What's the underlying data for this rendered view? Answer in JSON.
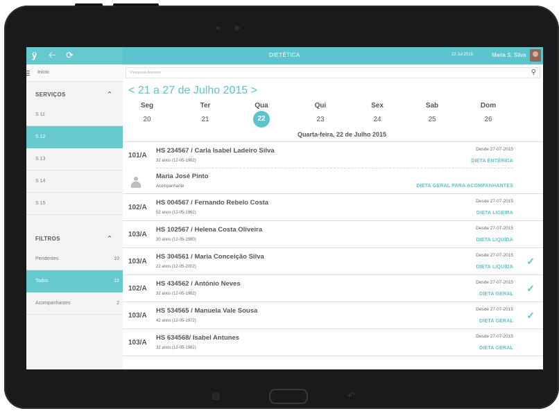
{
  "topbar": {
    "title": "DIETÉTICA",
    "date": "22 Jul 2015",
    "user": "Maria S. Silva",
    "icons": [
      "app-logo-icon",
      "back-arrow-icon",
      "refresh-icon"
    ]
  },
  "sidebar": {
    "start_label": "Início",
    "services_header": "SERVIÇOS",
    "services": [
      {
        "label": "S 11",
        "active": false
      },
      {
        "label": "S 12",
        "active": true
      },
      {
        "label": "S 13",
        "active": false
      },
      {
        "label": "S 14",
        "active": false
      },
      {
        "label": "S 15",
        "active": false
      }
    ],
    "filters_header": "FILTROS",
    "filters": [
      {
        "label": "Pendentes",
        "count": "10",
        "active": false
      },
      {
        "label": "Todos",
        "count": "12",
        "active": true
      },
      {
        "label": "Acompanhantes",
        "count": "2",
        "active": false
      }
    ]
  },
  "search": {
    "placeholder": "Pesquisa doentes"
  },
  "calendar": {
    "week_range": "< 21 a 27 de Julho 2015 >",
    "days": [
      {
        "name": "Seg",
        "num": "20"
      },
      {
        "name": "Ter",
        "num": "21"
      },
      {
        "name": "Qua",
        "num": "22",
        "selected": true
      },
      {
        "name": "Qui",
        "num": "23"
      },
      {
        "name": "Sex",
        "num": "24"
      },
      {
        "name": "Sab",
        "num": "25"
      },
      {
        "name": "Dom",
        "num": "26"
      }
    ],
    "full_date": "Quarta-feira, 22 de Julho 2015"
  },
  "patients": [
    {
      "bed": "101/A",
      "name": "HS 234567 / Carla Isabel Ladeiro Silva",
      "age": "32 anos (12-05-1982)",
      "since": "Desde 27-07-2015",
      "diet": "DIETA ENTÉRICA",
      "check": false,
      "companion": {
        "name": "Maria José Pinto",
        "role": "Acompanhante",
        "diet": "DIETA GERAL PARA ACOMPANHANTES"
      }
    },
    {
      "bed": "102/A",
      "name": "HS 004567 / Fernando Rebelo Costa",
      "age": "52 anos (12-05-1962)",
      "since": "Desde 27-07-2015",
      "diet": "DIETA LIGEIRA",
      "check": false
    },
    {
      "bed": "103/A",
      "name": "HS 102567 / Helena Costa Oliveira",
      "age": "30 anos (12-05-1980)",
      "since": "Desde 27-07-2015",
      "diet": "DIETA LIQUÍDA",
      "check": false
    },
    {
      "bed": "103/A",
      "name": "HS 304561 / Maria Conceição Silva",
      "age": "22 anos (12-05-2002)",
      "since": "Desde 27-07-2015",
      "diet": "DIETA LIQUÍDA",
      "check": true
    },
    {
      "bed": "102/A",
      "name": "HS 434562 / António Neves",
      "age": "32 anos (12-05-1982)",
      "since": "Desde 27-07-2015",
      "diet": "DIETA GERAL",
      "check": true
    },
    {
      "bed": "103/A",
      "name": "HS 534565 / Manuela Vale Sousa",
      "age": "42 anos (12-05-1972)",
      "since": "Desde 27-07-2015",
      "diet": "DIETA GERAL",
      "check": true
    },
    {
      "bed": "103/A",
      "name": "HS 634568/ Isabel Antunes",
      "age": "32 anos (12-05-1982)",
      "since": "Desde 27-07-2015",
      "diet": "DIETA GERAL",
      "check": false
    }
  ],
  "colors": {
    "accent": "#5bc4cc",
    "frame": "#1a1a1c"
  }
}
